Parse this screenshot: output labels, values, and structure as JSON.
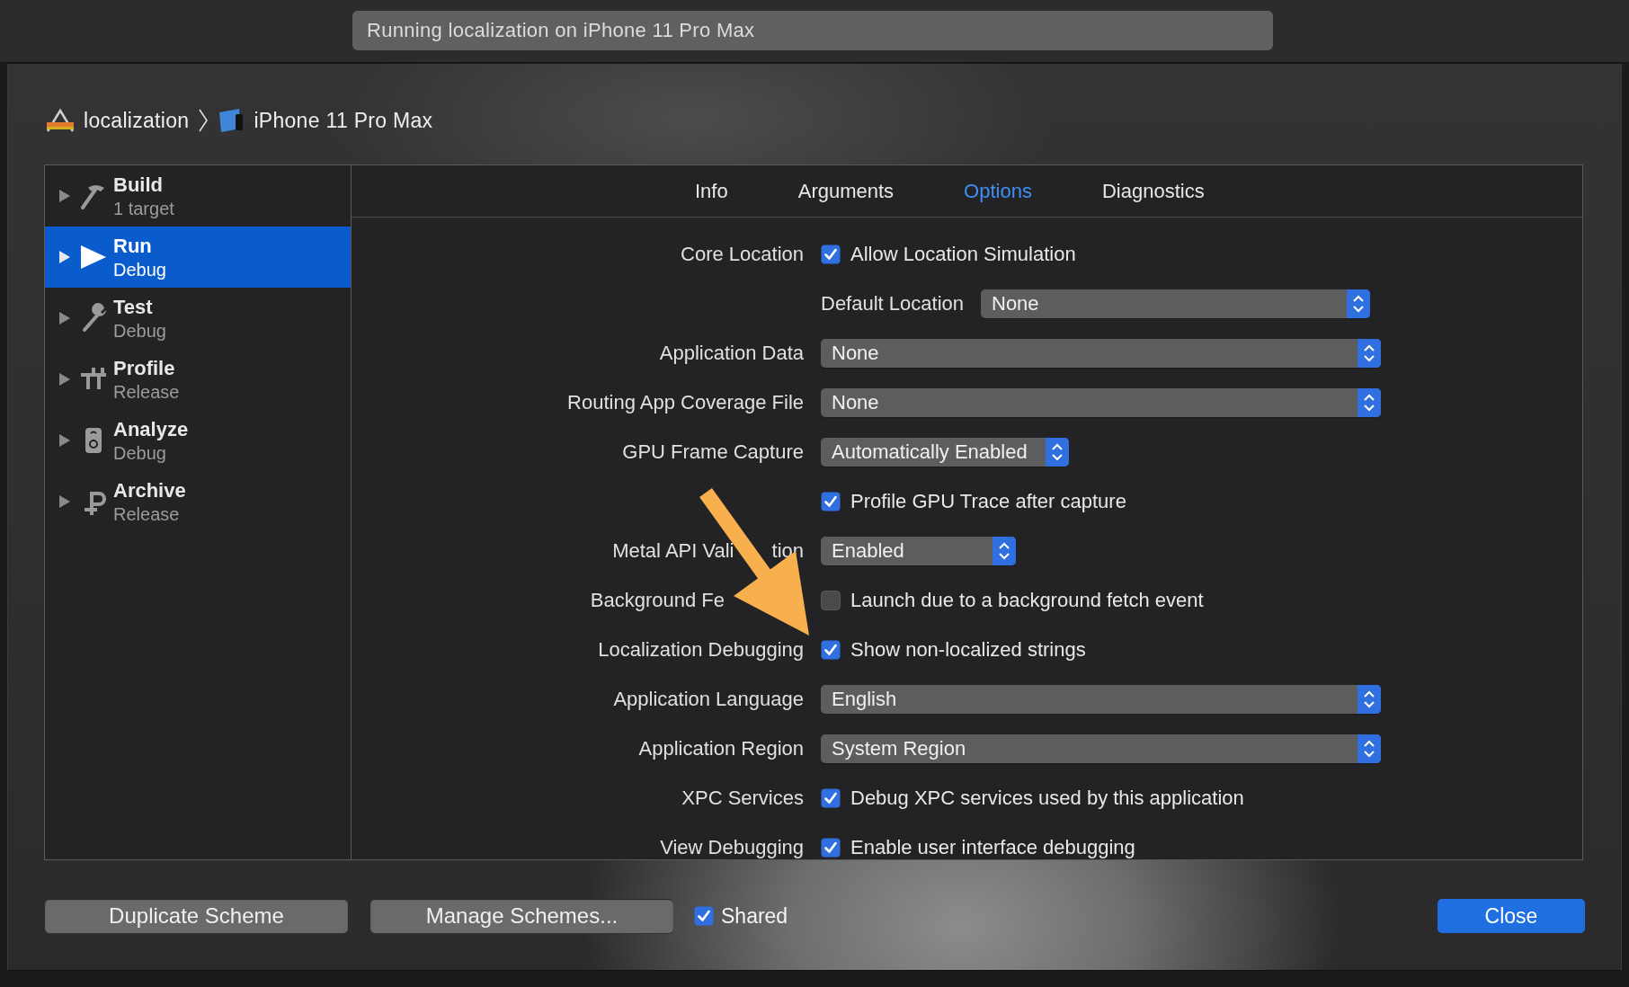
{
  "title_bar": {
    "status": "Running localization on iPhone 11 Pro Max"
  },
  "breadcrumb": [
    {
      "label": "localization",
      "kind": "project"
    },
    {
      "label": "iPhone 11 Pro Max",
      "kind": "device"
    }
  ],
  "sidebar": {
    "items": [
      {
        "title": "Build",
        "subtitle": "1 target",
        "kind": "build",
        "selected": false,
        "expanded": false
      },
      {
        "title": "Run",
        "subtitle": "Debug",
        "kind": "run",
        "selected": true,
        "expanded": false
      },
      {
        "title": "Test",
        "subtitle": "Debug",
        "kind": "test",
        "selected": false,
        "expanded": false
      },
      {
        "title": "Profile",
        "subtitle": "Release",
        "kind": "profile",
        "selected": false,
        "expanded": false
      },
      {
        "title": "Analyze",
        "subtitle": "Debug",
        "kind": "analyze",
        "selected": false,
        "expanded": false
      },
      {
        "title": "Archive",
        "subtitle": "Release",
        "kind": "archive",
        "selected": false,
        "expanded": false
      }
    ]
  },
  "tabs": [
    {
      "label": "Info",
      "selected": false
    },
    {
      "label": "Arguments",
      "selected": false
    },
    {
      "label": "Options",
      "selected": true
    },
    {
      "label": "Diagnostics",
      "selected": false
    }
  ],
  "options": [
    {
      "kind": "checkbox",
      "label": "Core Location",
      "text": "Allow Location Simulation",
      "checked": true
    },
    {
      "kind": "sub_popup",
      "label": "Default Location",
      "value": "None"
    },
    {
      "kind": "popup",
      "label": "Application Data",
      "value": "None"
    },
    {
      "kind": "popup",
      "label": "Routing App Coverage File",
      "value": "None"
    },
    {
      "kind": "compact_popup",
      "label": "GPU Frame Capture",
      "value": "Automatically Enabled"
    },
    {
      "kind": "sub_checkbox",
      "text": "Profile GPU Trace after capture",
      "checked": true
    },
    {
      "kind": "compact_popup",
      "label": "Metal API Vali",
      "label_tail": "tion",
      "value": "Enabled"
    },
    {
      "kind": "checkbox",
      "label": "Background Fe",
      "covered": true,
      "text": "Launch due to a background fetch event",
      "checked": false
    },
    {
      "kind": "checkbox",
      "label": "Localization Debugging",
      "text": "Show non-localized strings",
      "checked": true
    },
    {
      "kind": "popup",
      "label": "Application Language",
      "value": "English"
    },
    {
      "kind": "popup",
      "label": "Application Region",
      "value": "System Region"
    },
    {
      "kind": "checkbox",
      "label": "XPC Services",
      "text": "Debug XPC services used by this application",
      "checked": true
    },
    {
      "kind": "checkbox",
      "label": "View Debugging",
      "text": "Enable user interface debugging",
      "checked": true
    }
  ],
  "footer": {
    "buttons": [
      {
        "label": "Duplicate Scheme"
      },
      {
        "label": "Manage Schemes..."
      }
    ],
    "shared": {
      "label": "Shared",
      "checked": true
    },
    "close_button": {
      "label": "Close"
    }
  }
}
